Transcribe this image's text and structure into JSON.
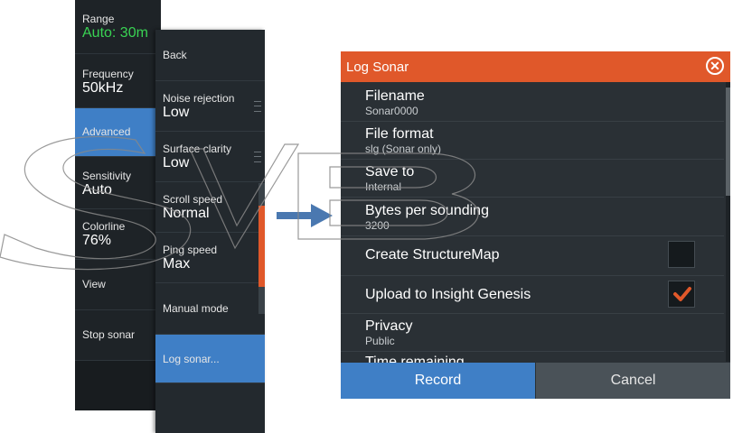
{
  "menu1": {
    "items": [
      {
        "label": "Range",
        "value": "Auto: 30m"
      },
      {
        "label": "Frequency",
        "value": "50kHz"
      },
      {
        "label": "Advanced",
        "value": ""
      },
      {
        "label": "Sensitivity",
        "value": "Auto"
      },
      {
        "label": "Colorline",
        "value": "76%"
      },
      {
        "label": "View",
        "value": ""
      },
      {
        "label": "Stop sonar",
        "value": ""
      }
    ]
  },
  "menu2": {
    "items": [
      {
        "label": "Back",
        "value": ""
      },
      {
        "label": "Noise rejection",
        "value": "Low"
      },
      {
        "label": "Surface clarity",
        "value": "Low"
      },
      {
        "label": "Scroll speed",
        "value": "Normal"
      },
      {
        "label": "Ping speed",
        "value": "Max"
      },
      {
        "label": "Manual mode",
        "value": ""
      },
      {
        "label": "Log sonar...",
        "value": ""
      }
    ]
  },
  "dialog": {
    "title": "Log Sonar",
    "rows": [
      {
        "label": "Filename",
        "value": "Sonar0000"
      },
      {
        "label": "File format",
        "value": "slg (Sonar only)"
      },
      {
        "label": "Save to",
        "value": "Internal"
      },
      {
        "label": "Bytes per sounding",
        "value": "3200"
      },
      {
        "label": "Create StructureMap",
        "checked": false
      },
      {
        "label": "Upload to Insight Genesis",
        "checked": true
      },
      {
        "label": "Privacy",
        "value": "Public"
      },
      {
        "label": "Time remaining",
        "value": ""
      }
    ],
    "record_label": "Record",
    "cancel_label": "Cancel"
  },
  "colors": {
    "accent_blue": "#3f7fc6",
    "accent_orange": "#e0582a",
    "range_green": "#39d353",
    "panel_dark": "#23292e"
  }
}
